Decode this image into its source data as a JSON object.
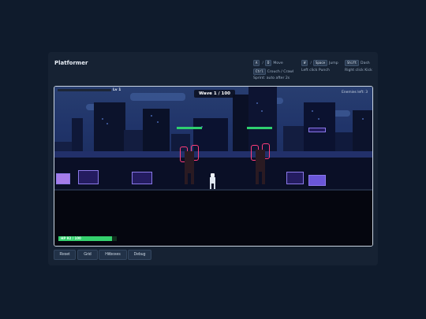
{
  "header": {
    "title": "Platformer"
  },
  "controls": {
    "move_key_a": "A",
    "move_key_sep": "/",
    "move_key_d": "D",
    "move_label": "Move",
    "jump_key_w": "W",
    "jump_key_sep": "/",
    "jump_key_space": "Space",
    "jump_label": "Jump",
    "dash_key": "Shift",
    "dash_label": "Dash",
    "crouch_key": "Ctrl",
    "crouch_label": "Crouch / Crawl",
    "punch_label": "Left click Punch",
    "kick_label": "Right click Kick",
    "sprint_label": "Sprint: auto after 2s"
  },
  "hud": {
    "level": "Lv 1",
    "wave": "Wave 1 / 100",
    "enemies_left": "Enemies left: 3",
    "hp_text": "HP 92 / 100",
    "hp_fraction": 0.92,
    "xp_fraction": 0.0
  },
  "enemies": [
    {
      "hp_fraction": 1.0
    },
    {
      "hp_fraction": 1.0
    }
  ],
  "buttons": {
    "reset": "Reset",
    "grid": "Grid",
    "hitboxes": "Hitboxes",
    "debug": "Debug"
  },
  "colors": {
    "page_bg": "#0f1b2c",
    "panel_bg": "#162233",
    "hp_green": "#35d06e",
    "enemy_glow": "#ff3d7a"
  }
}
